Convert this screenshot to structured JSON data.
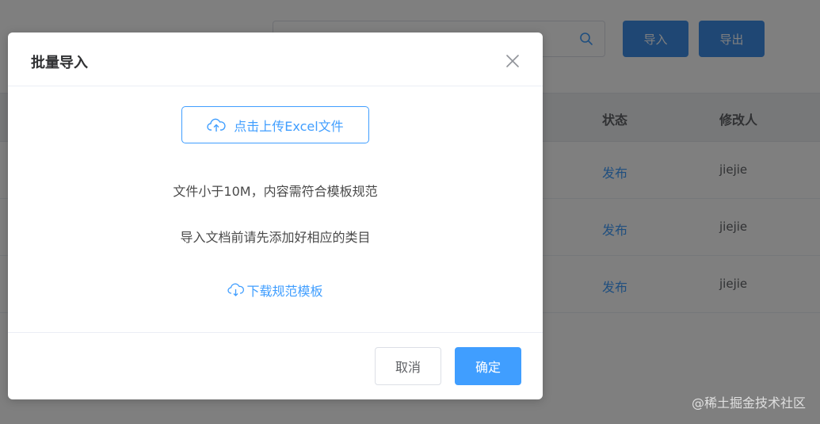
{
  "background": {
    "buttons": {
      "import_label": "导入",
      "export_label": "导出"
    },
    "table": {
      "headers": {
        "status": "状态",
        "modifier": "修改人"
      },
      "rows": [
        {
          "status": "发布",
          "modifier": "jiejie"
        },
        {
          "status": "发布",
          "modifier": "jiejie"
        },
        {
          "status": "发布",
          "modifier": "jiejie"
        }
      ]
    }
  },
  "dialog": {
    "title": "批量导入",
    "upload_label": "点击上传Excel文件",
    "tips": [
      "文件小于10M，内容需符合模板规范",
      "导入文档前请先添加好相应的类目"
    ],
    "download_label": "下载规范模板",
    "cancel_label": "取消",
    "confirm_label": "确定"
  },
  "watermark": "@稀土掘金技术社区",
  "colors": {
    "primary": "#409eff",
    "overlay": "rgba(0,0,0,0.5)"
  }
}
